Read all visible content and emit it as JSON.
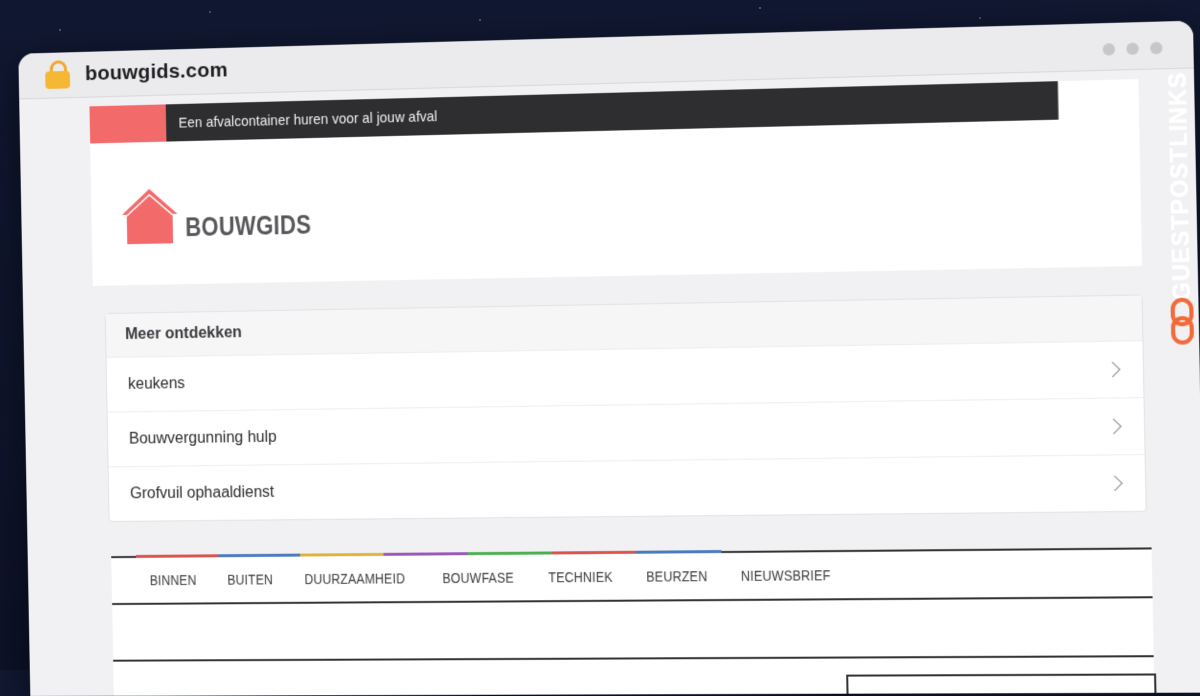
{
  "browser": {
    "domain": "bouwgids.com"
  },
  "side_brand": {
    "text": "GUESTPOSTLINKS",
    "accent_color": "#f26a3a"
  },
  "site": {
    "ticker_text": "Een afvalcontainer huren voor al jouw afval",
    "accent_color": "#f26a6a",
    "logo_text": "BOUWGIDS"
  },
  "discover": {
    "title": "Meer ontdekken",
    "items": [
      {
        "label": "keukens"
      },
      {
        "label": "Bouwvergunning hulp"
      },
      {
        "label": "Grofvuil ophaaldienst"
      }
    ]
  },
  "nav": {
    "items": [
      {
        "label": "BINNEN",
        "color": "#d9534f"
      },
      {
        "label": "BUITEN",
        "color": "#4a7bbd"
      },
      {
        "label": "DUURZAAMHEID",
        "color": "#e2b13c"
      },
      {
        "label": "BOUWFASE",
        "color": "#9b59b6"
      },
      {
        "label": "TECHNIEK",
        "color": "#4caf50"
      },
      {
        "label": "BEURZEN",
        "color": "#d9534f"
      },
      {
        "label": "NIEUWSBRIEF",
        "color": "#4a7bbd"
      }
    ]
  }
}
